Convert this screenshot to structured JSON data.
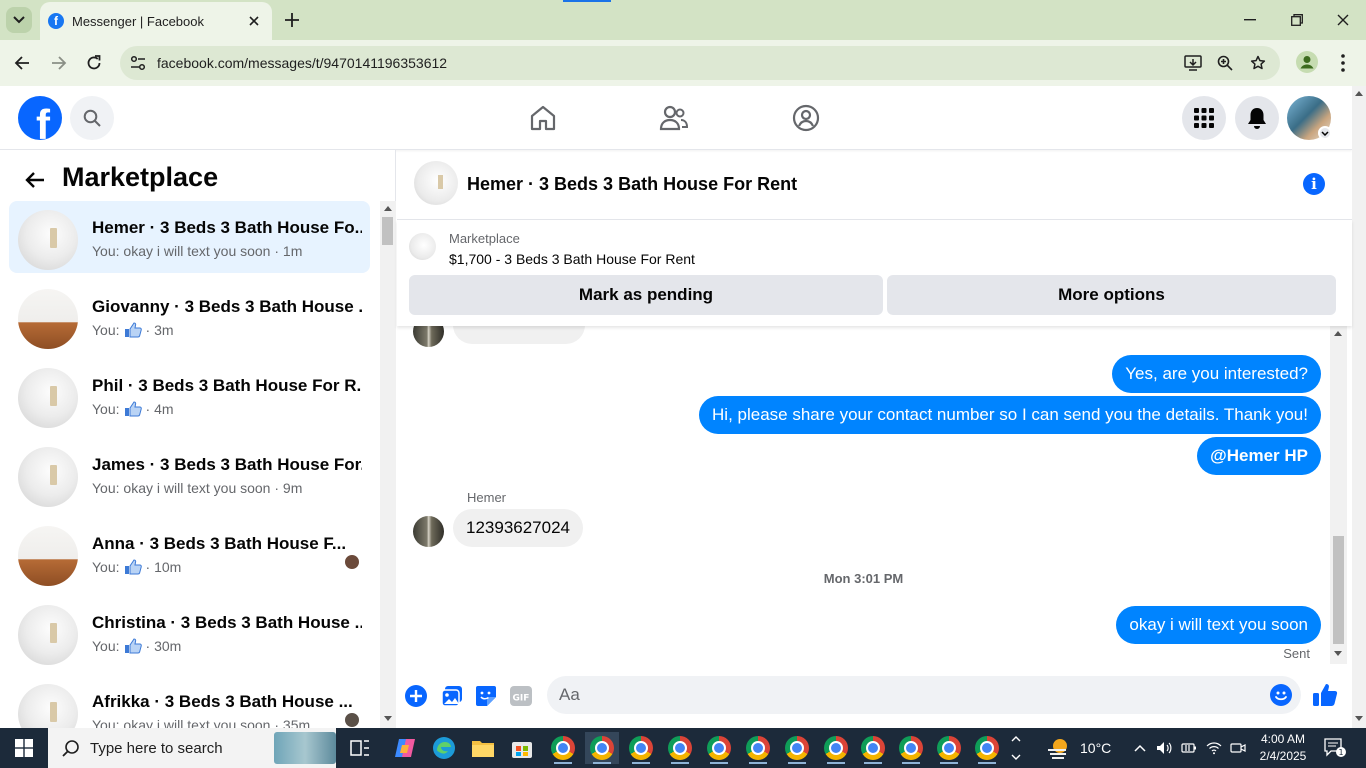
{
  "browser": {
    "tab_title": "Messenger | Facebook",
    "url": "facebook.com/messages/t/9470141196353612"
  },
  "left_panel": {
    "title": "Marketplace",
    "conversations": [
      {
        "name": "Hemer · 3 Beds 3 Bath House Fo...",
        "preview": "You: okay i will text you soon · 1m",
        "thumb": "empty"
      },
      {
        "name": "Giovanny · 3 Beds 3 Bath House ...",
        "preview_prefix": "You:",
        "preview_time": "· 3m",
        "thumb": "room"
      },
      {
        "name": "Phil · 3 Beds 3 Bath House For R...",
        "preview_prefix": "You:",
        "preview_time": "· 4m",
        "thumb": "empty"
      },
      {
        "name": "James · 3 Beds 3 Bath House For...",
        "preview": "You: okay i will text you soon · 9m",
        "thumb": "empty"
      },
      {
        "name": "Anna · 3 Beds 3 Bath House F...",
        "preview_prefix": "You:",
        "preview_time": "· 10m",
        "thumb": "room"
      },
      {
        "name": "Christina · 3 Beds 3 Bath House ...",
        "preview_prefix": "You:",
        "preview_time": "· 30m",
        "thumb": "empty"
      },
      {
        "name": "Afrikka · 3 Beds 3 Bath House ...",
        "preview": "You: okay i will text you soon · 35m",
        "thumb": "empty"
      }
    ]
  },
  "chat": {
    "title": "Hemer · 3 Beds 3 Bath House For Rent",
    "listing": {
      "label": "Marketplace",
      "price_title": "$1,700 - 3 Beds 3 Bath House For Rent",
      "btn_pending": "Mark as pending",
      "btn_more": "More options"
    },
    "messages": {
      "out1": "Yes, are you interested?",
      "out2": "Hi, please share your contact number so I can send you the details. Thank you!",
      "out3": "@Hemer  HP",
      "sender": "Hemer",
      "in1": "12393627024",
      "timestamp": "Mon 3:01 PM",
      "out4": "okay i will text you soon",
      "status": "Sent"
    },
    "composer": {
      "placeholder": "Aa"
    }
  },
  "taskbar": {
    "search_placeholder": "Type here to search",
    "temperature": "10°C",
    "time": "4:00 AM",
    "date": "2/4/2025",
    "notification_count": "1"
  },
  "colors": {
    "messenger_blue": "#0084ff",
    "facebook_blue": "#0866ff",
    "active_conv_bg": "#e7f3ff",
    "chrome_tabbar": "#d3e3c5"
  }
}
